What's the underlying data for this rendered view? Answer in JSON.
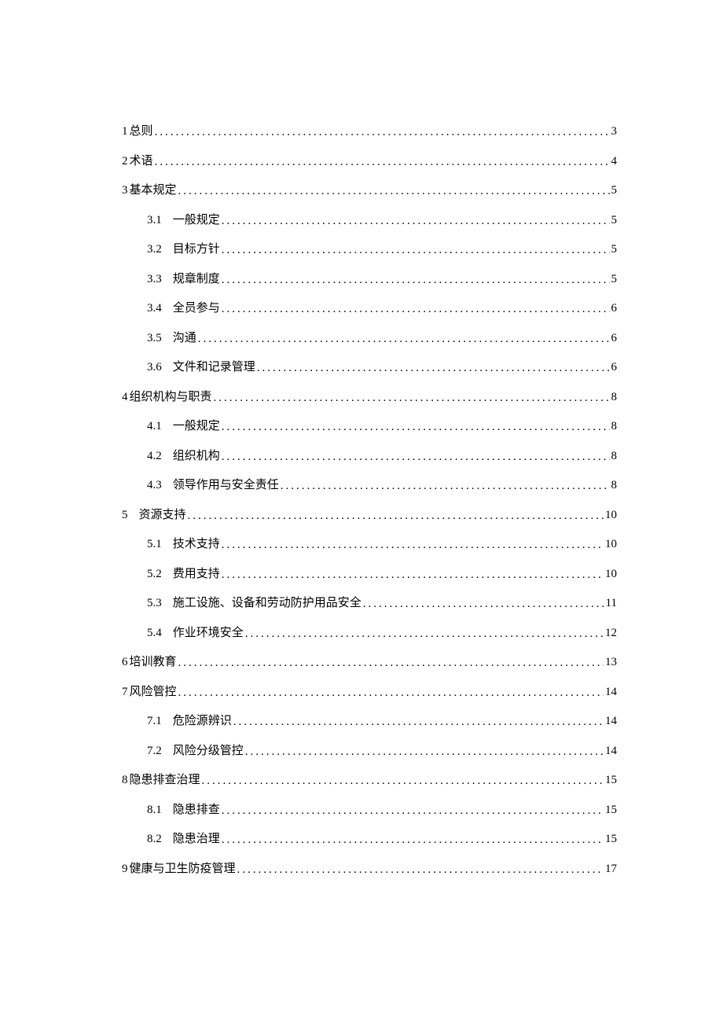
{
  "toc": [
    {
      "level": 1,
      "num": "1",
      "title": "总则",
      "page": "3"
    },
    {
      "level": 1,
      "num": "2",
      "title": "术语",
      "page": "4"
    },
    {
      "level": 1,
      "num": "3",
      "title": "基本规定",
      "page": "5"
    },
    {
      "level": 2,
      "num": "3.1",
      "title": "一般规定",
      "page": "5"
    },
    {
      "level": 2,
      "num": "3.2",
      "title": "目标方针",
      "page": "5"
    },
    {
      "level": 2,
      "num": "3.3",
      "title": "规章制度",
      "page": "5"
    },
    {
      "level": 2,
      "num": "3.4",
      "title": "全员参与",
      "page": "6"
    },
    {
      "level": 2,
      "num": "3.5",
      "title": "沟通",
      "page": "6"
    },
    {
      "level": 2,
      "num": "3.6",
      "title": "文件和记录管理",
      "page": "6"
    },
    {
      "level": 1,
      "num": "4",
      "title": "组织机构与职责",
      "page": "8"
    },
    {
      "level": 2,
      "num": "4.1",
      "title": "一般规定",
      "page": "8"
    },
    {
      "level": 2,
      "num": "4.2",
      "title": "组织机构",
      "page": "8"
    },
    {
      "level": 2,
      "num": "4.3",
      "title": "领导作用与安全责任",
      "page": "8"
    },
    {
      "level": 1,
      "num": "5",
      "title": "资源支持",
      "page": "10",
      "wideGap": true
    },
    {
      "level": 2,
      "num": "5.1",
      "title": "技术支持",
      "page": "10"
    },
    {
      "level": 2,
      "num": "5.2",
      "title": "费用支持",
      "page": "10"
    },
    {
      "level": 2,
      "num": "5.3",
      "title": "施工设施、设备和劳动防护用品安全",
      "page": "11"
    },
    {
      "level": 2,
      "num": "5.4",
      "title": "作业环境安全",
      "page": "12"
    },
    {
      "level": 1,
      "num": "6",
      "title": "培训教育",
      "page": "13"
    },
    {
      "level": 1,
      "num": "7",
      "title": "风险管控",
      "page": "14"
    },
    {
      "level": 2,
      "num": "7.1",
      "title": "危险源辨识",
      "page": "14"
    },
    {
      "level": 2,
      "num": "7.2",
      "title": "风险分级管控",
      "page": "14"
    },
    {
      "level": 1,
      "num": "8",
      "title": "隐患排查治理",
      "page": "15"
    },
    {
      "level": 2,
      "num": "8.1",
      "title": "隐患排查",
      "page": "15"
    },
    {
      "level": 2,
      "num": "8.2",
      "title": "隐患治理",
      "page": "15"
    },
    {
      "level": 1,
      "num": "9",
      "title": "健康与卫生防疫管理",
      "page": "17"
    }
  ]
}
